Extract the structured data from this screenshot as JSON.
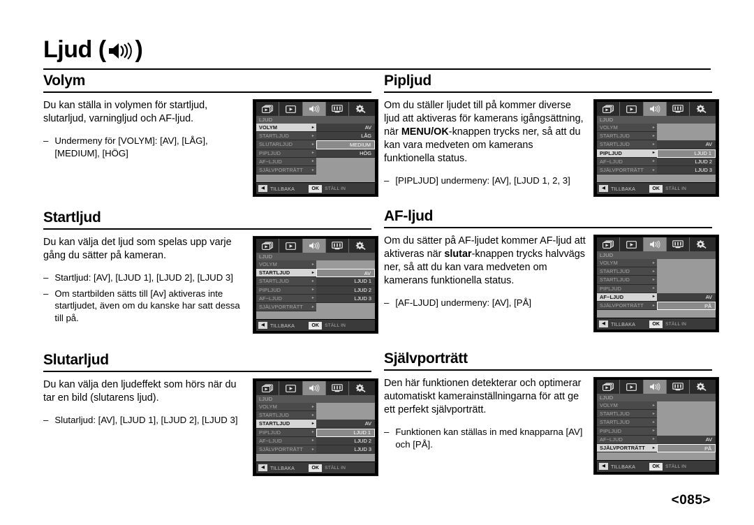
{
  "page": {
    "title": "Ljud",
    "title_icon": "speaker-icon",
    "page_number": "<085>"
  },
  "menu_common": {
    "menu_title": "LJUD",
    "tabs": [
      "camera-mode-icon",
      "playback-icon",
      "sound-icon",
      "display-icon",
      "settings-gear-icon"
    ],
    "active_tab_index": 2,
    "back_label": "TILLBAKA",
    "ok_label": "OK",
    "set_label": "STÄLL IN",
    "arrow": "▸",
    "back_arrow": "◀"
  },
  "sections": [
    {
      "id": "volym",
      "heading": "Volym",
      "paragraph": "Du kan ställa in volymen för startljud, slutarljud, varningljud och AF-ljud.",
      "bullets": [
        "Undermeny för [VOLYM]: [AV], [LÅG], [MEDIUM], [HÖG]"
      ],
      "menu": {
        "rows": [
          {
            "label": "VOLYM",
            "selected": true,
            "value": "AV",
            "value_style": "filled"
          },
          {
            "label": "STARTLJUD",
            "selected": false,
            "value": "LÅG",
            "value_style": "filled"
          },
          {
            "label": "SLUTARLJUD",
            "selected": false,
            "value": "MEDIUM",
            "value_style": "hl"
          },
          {
            "label": "PIPLJUD",
            "selected": false,
            "value": "HÖG",
            "value_style": "filled"
          },
          {
            "label": "AF−LJUD",
            "selected": false,
            "value": "",
            "value_style": "empty"
          },
          {
            "label": "SJÄLVPORTRÄTT",
            "selected": false,
            "value": "",
            "value_style": "empty"
          }
        ]
      }
    },
    {
      "id": "startljud",
      "heading": "Startljud",
      "paragraph": "Du kan välja det ljud som spelas upp varje gång du sätter på kameran.",
      "bullets": [
        "Startljud: [AV], [LJUD 1], [LJUD 2], [LJUD 3]",
        "Om startbilden sätts till [Av] aktiveras inte startljudet, även om du kanske har satt dessa till på."
      ],
      "menu": {
        "rows": [
          {
            "label": "VOLYM",
            "selected": false,
            "value": "",
            "value_style": "empty"
          },
          {
            "label": "STARTLJUD",
            "selected": true,
            "value": "AV",
            "value_style": "hl"
          },
          {
            "label": "STARTLJUD",
            "selected": false,
            "value": "LJUD 1",
            "value_style": "filled"
          },
          {
            "label": "PIPLJUD",
            "selected": false,
            "value": "LJUD 2",
            "value_style": "filled"
          },
          {
            "label": "AF−LJUD",
            "selected": false,
            "value": "LJUD 3",
            "value_style": "filled"
          },
          {
            "label": "SJÄLVPORTRÄTT",
            "selected": false,
            "value": "",
            "value_style": "empty"
          }
        ]
      }
    },
    {
      "id": "slutarljud",
      "heading": "Slutarljud",
      "paragraph": "Du kan välja den ljudeffekt som hörs när du tar en bild (slutarens ljud).",
      "bullets": [
        "Slutarljud: [AV], [LJUD 1], [LJUD 2], [LJUD 3]"
      ],
      "menu": {
        "rows": [
          {
            "label": "VOLYM",
            "selected": false,
            "value": "",
            "value_style": "empty"
          },
          {
            "label": "STARTLJUD",
            "selected": false,
            "value": "",
            "value_style": "empty"
          },
          {
            "label": "STARTLJUD",
            "selected": true,
            "value": "AV",
            "value_style": "filled"
          },
          {
            "label": "PIPLJUD",
            "selected": false,
            "value": "LJUD 1",
            "value_style": "hl"
          },
          {
            "label": "AF−LJUD",
            "selected": false,
            "value": "LJUD 2",
            "value_style": "filled"
          },
          {
            "label": "SJÄLVPORTRÄTT",
            "selected": false,
            "value": "LJUD 3",
            "value_style": "filled"
          }
        ]
      }
    },
    {
      "id": "pipljud",
      "heading": "Pipljud",
      "paragraph_parts": [
        {
          "text": "Om du ställer ljudet till på kommer diverse ljud att aktiveras för kamerans igångsättning, när ",
          "bold": false
        },
        {
          "text": "MENU/OK",
          "bold": true
        },
        {
          "text": "-knappen trycks ner, så att du kan vara medveten om kamerans funktionella status.",
          "bold": false
        }
      ],
      "bullets": [
        "[PIPLJUD] undermeny: [AV], [LJUD 1, 2, 3]"
      ],
      "menu": {
        "rows": [
          {
            "label": "VOLYM",
            "selected": false,
            "value": "",
            "value_style": "empty"
          },
          {
            "label": "STARTLJUD",
            "selected": false,
            "value": "",
            "value_style": "empty"
          },
          {
            "label": "STARTLJUD",
            "selected": false,
            "value": "AV",
            "value_style": "filled"
          },
          {
            "label": "PIPLJUD",
            "selected": true,
            "value": "LJUD 1",
            "value_style": "hl"
          },
          {
            "label": "AF−LJUD",
            "selected": false,
            "value": "LJUD 2",
            "value_style": "filled"
          },
          {
            "label": "SJÄLVPORTRÄTT",
            "selected": false,
            "value": "LJUD 3",
            "value_style": "filled"
          }
        ]
      }
    },
    {
      "id": "af-ljud",
      "heading": "AF-ljud",
      "paragraph_parts": [
        {
          "text": "Om du sätter på AF-ljudet kommer AF-ljud att aktiveras när ",
          "bold": false
        },
        {
          "text": "slutar",
          "bold": true
        },
        {
          "text": "-knappen trycks halvvägs ner, så att du kan vara medveten om kamerans funktionella status.",
          "bold": false
        }
      ],
      "bullets": [
        "[AF-LJUD] undermeny: [AV], [PÅ]"
      ],
      "menu": {
        "rows": [
          {
            "label": "VOLYM",
            "selected": false,
            "value": "",
            "value_style": "empty"
          },
          {
            "label": "STARTLJUD",
            "selected": false,
            "value": "",
            "value_style": "empty"
          },
          {
            "label": "STARTLJUD",
            "selected": false,
            "value": "",
            "value_style": "empty"
          },
          {
            "label": "PIPLJUD",
            "selected": false,
            "value": "",
            "value_style": "empty"
          },
          {
            "label": "AF−LJUD",
            "selected": true,
            "value": "AV",
            "value_style": "filled"
          },
          {
            "label": "SJÄLVPORTRÄTT",
            "selected": false,
            "value": "PÅ",
            "value_style": "hl"
          }
        ]
      }
    },
    {
      "id": "sjalvportratt",
      "heading": "Självporträtt",
      "paragraph": "Den här funktionen detekterar och optimerar automatiskt kamerainställningarna för att ge ett perfekt självporträtt.",
      "bullets": [
        "Funktionen kan ställas in med knapparna [AV] och [PÅ]."
      ],
      "menu": {
        "rows": [
          {
            "label": "VOLYM",
            "selected": false,
            "value": "",
            "value_style": "empty"
          },
          {
            "label": "STARTLJUD",
            "selected": false,
            "value": "",
            "value_style": "empty"
          },
          {
            "label": "STARTLJUD",
            "selected": false,
            "value": "",
            "value_style": "empty"
          },
          {
            "label": "PIPLJUD",
            "selected": false,
            "value": "",
            "value_style": "empty"
          },
          {
            "label": "AF−LJUD",
            "selected": false,
            "value": "AV",
            "value_style": "filled"
          },
          {
            "label": "SJÄLVPORTRÄTT",
            "selected": true,
            "value": "PÅ",
            "value_style": "hl"
          }
        ]
      }
    }
  ],
  "layout": {
    "left_column_section_ids": [
      "volym",
      "startljud",
      "slutarljud"
    ],
    "right_column_section_ids": [
      "pipljud",
      "af-ljud",
      "sjalvportratt"
    ],
    "left_tops": [
      0,
      196,
      400
    ],
    "right_tops": [
      0,
      194,
      398
    ]
  },
  "colors": {
    "text": "#000000",
    "lcd_background": "#000000",
    "lcd_panel": "#9a9a9a",
    "lcd_label": "#4a4a4a",
    "lcd_selected_label": "#d6d6d6",
    "lcd_value": "#3f3f3f"
  }
}
